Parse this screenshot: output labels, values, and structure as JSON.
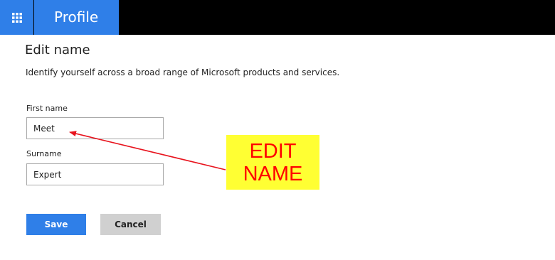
{
  "header": {
    "apps_icon": "app-grid-icon",
    "title": "Profile",
    "accent_color": "#2f7fe8",
    "bar_color": "#000000"
  },
  "main": {
    "title": "Edit name",
    "description": "Identify yourself across a broad range of Microsoft products and services.",
    "first_name": {
      "label": "First name",
      "value": "Meet"
    },
    "surname": {
      "label": "Surname",
      "value": "Expert"
    },
    "save_label": "Save",
    "cancel_label": "Cancel"
  },
  "annotation": {
    "line1": "EDIT",
    "line2": "NAME",
    "background_color": "#ffff33",
    "text_color": "#ff0000"
  }
}
